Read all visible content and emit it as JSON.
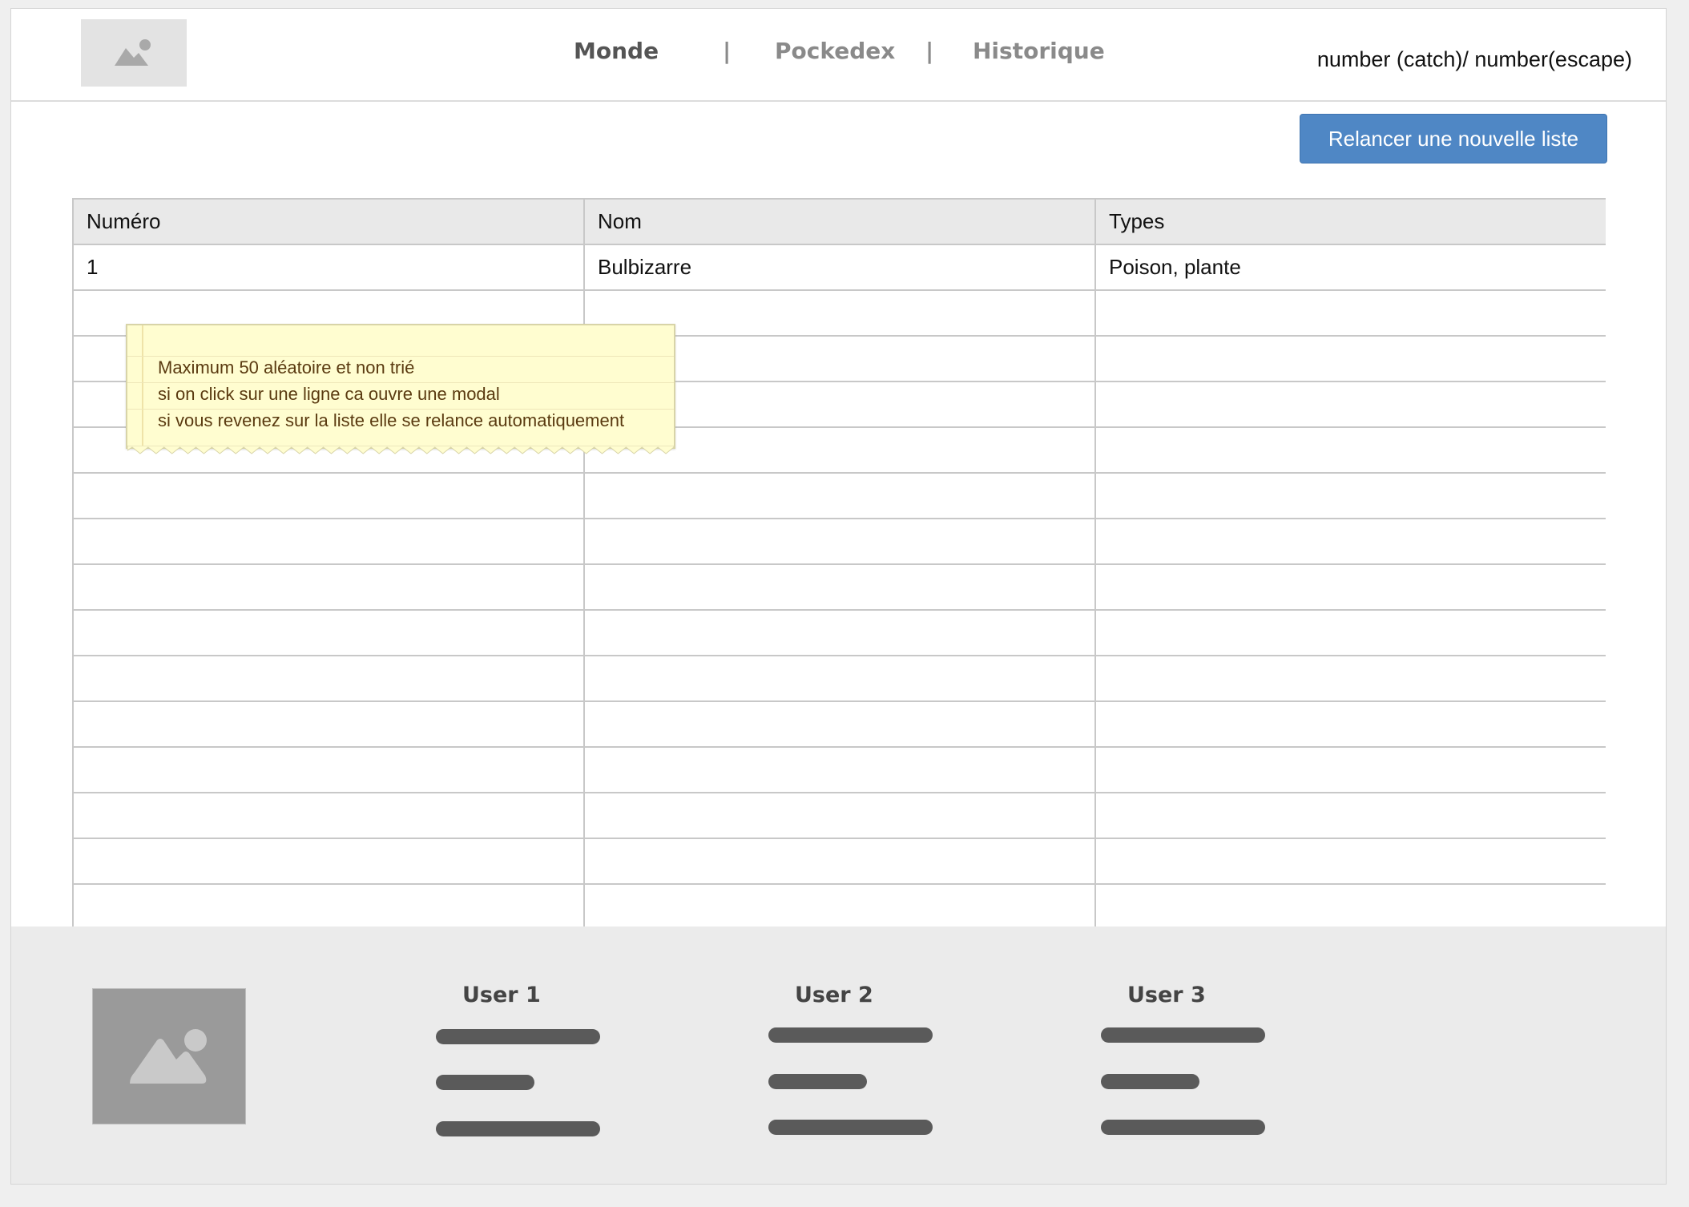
{
  "header": {
    "nav": {
      "monde": "Monde",
      "separator": "|",
      "pockedex": "Pockedex",
      "historique": "Historique"
    },
    "counter": "number (catch)/ number(escape)"
  },
  "toolbar": {
    "refresh_label": "Relancer une nouvelle liste"
  },
  "table": {
    "headers": [
      "Numéro",
      "Nom",
      "Types"
    ],
    "rows": [
      [
        "1",
        "Bulbizarre",
        "Poison, plante"
      ],
      [
        "",
        "",
        ""
      ],
      [
        "",
        "",
        ""
      ],
      [
        "",
        "",
        ""
      ],
      [
        "",
        "",
        ""
      ],
      [
        "",
        "",
        ""
      ],
      [
        "",
        "",
        ""
      ],
      [
        "",
        "",
        ""
      ],
      [
        "",
        "",
        ""
      ],
      [
        "",
        "",
        ""
      ],
      [
        "",
        "",
        ""
      ],
      [
        "",
        "",
        ""
      ],
      [
        "",
        "",
        ""
      ],
      [
        "",
        "",
        ""
      ],
      [
        "",
        "",
        ""
      ]
    ]
  },
  "note": {
    "lines": [
      "Maximum 50 aléatoire et non trié",
      "si on click sur une ligne ca ouvre une modal",
      "si vous revenez sur la liste elle se relance automatiquement"
    ]
  },
  "footer": {
    "users": [
      {
        "name": "User 1"
      },
      {
        "name": "User 2"
      },
      {
        "name": "User 3"
      }
    ]
  },
  "icons": {
    "logo": "image-placeholder-icon",
    "footer_image": "image-placeholder-icon"
  }
}
